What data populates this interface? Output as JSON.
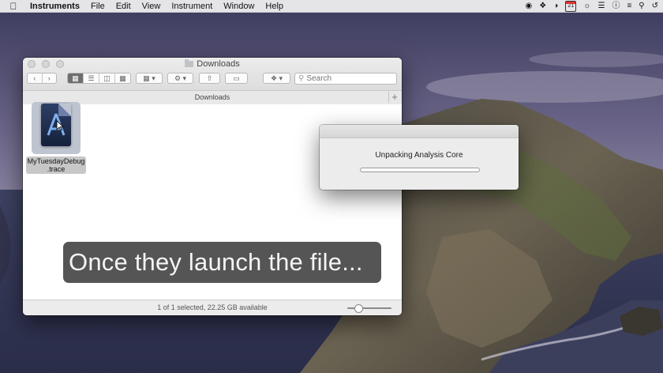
{
  "menubar": {
    "apple": "",
    "app_name": "Instruments",
    "items": [
      "File",
      "Edit",
      "View",
      "Instrument",
      "Window",
      "Help"
    ],
    "calendar_day": "21"
  },
  "finder": {
    "title": "Downloads",
    "path_label": "Downloads",
    "search_placeholder": "Search",
    "file_name_line1": "MyTuesdayDebug",
    "file_name_line2": ".trace",
    "status_text": "1 of 1 selected, 22.25 GB available"
  },
  "dialog": {
    "message": "Unpacking Analysis Core",
    "progress": 0.0
  },
  "caption": {
    "text": "Once they launch the file..."
  },
  "colors": {
    "progress_fill": "#6ba4ec",
    "caption_bg": "#464648"
  }
}
